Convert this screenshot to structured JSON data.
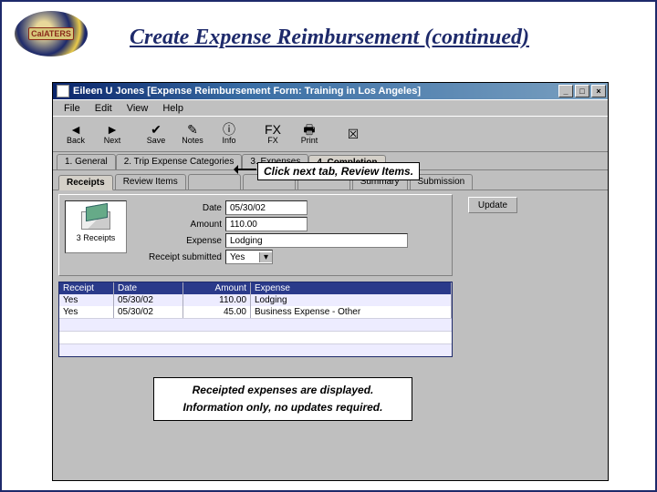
{
  "page": {
    "title": "Create Expense Reimbursement (continued)",
    "logo_text": "CalATERS"
  },
  "window": {
    "title": "Eileen U Jones [Expense Reimbursement Form: Training in Los Angeles]"
  },
  "menubar": [
    "File",
    "Edit",
    "View",
    "Help"
  ],
  "toolbar": [
    {
      "icon": "◄",
      "label": "Back"
    },
    {
      "icon": "►",
      "label": "Next"
    },
    {
      "icon": "✔",
      "label": "Save"
    },
    {
      "icon": "✎",
      "label": "Notes"
    },
    {
      "icon": "ⓘ",
      "label": "Info"
    },
    {
      "icon": "FX",
      "label": "FX"
    },
    {
      "icon": "🖶",
      "label": "Print"
    },
    {
      "icon": "☒",
      "label": "☑"
    }
  ],
  "tabs": {
    "main": [
      "1. General",
      "2. Trip Expense Categories",
      "3. Expenses",
      "4. Completion"
    ],
    "active_main": 3,
    "sub": [
      "Receipts",
      "Review Items",
      "",
      "",
      "",
      "Summary",
      "Submission"
    ],
    "active_sub": 0
  },
  "callouts": {
    "next_tab": "Click next tab, Review Items.",
    "info_line1": "Receipted expenses are displayed.",
    "info_line2": "Information only, no updates required."
  },
  "receipts_box": {
    "count_label": "3 Receipts"
  },
  "form": {
    "date_label": "Date",
    "date_value": "05/30/02",
    "amount_label": "Amount",
    "amount_value": "110.00",
    "expense_label": "Expense",
    "expense_value": "Lodging",
    "submitted_label": "Receipt submitted",
    "submitted_value": "Yes",
    "update_btn": "Update"
  },
  "grid": {
    "headers": {
      "receipt": "Receipt",
      "date": "Date",
      "amount": "Amount",
      "expense": "Expense"
    },
    "rows": [
      {
        "receipt": "Yes",
        "date": "05/30/02",
        "amount": "110.00",
        "expense": "Lodging"
      },
      {
        "receipt": "Yes",
        "date": "05/30/02",
        "amount": "45.00",
        "expense": "Business Expense - Other"
      }
    ]
  }
}
